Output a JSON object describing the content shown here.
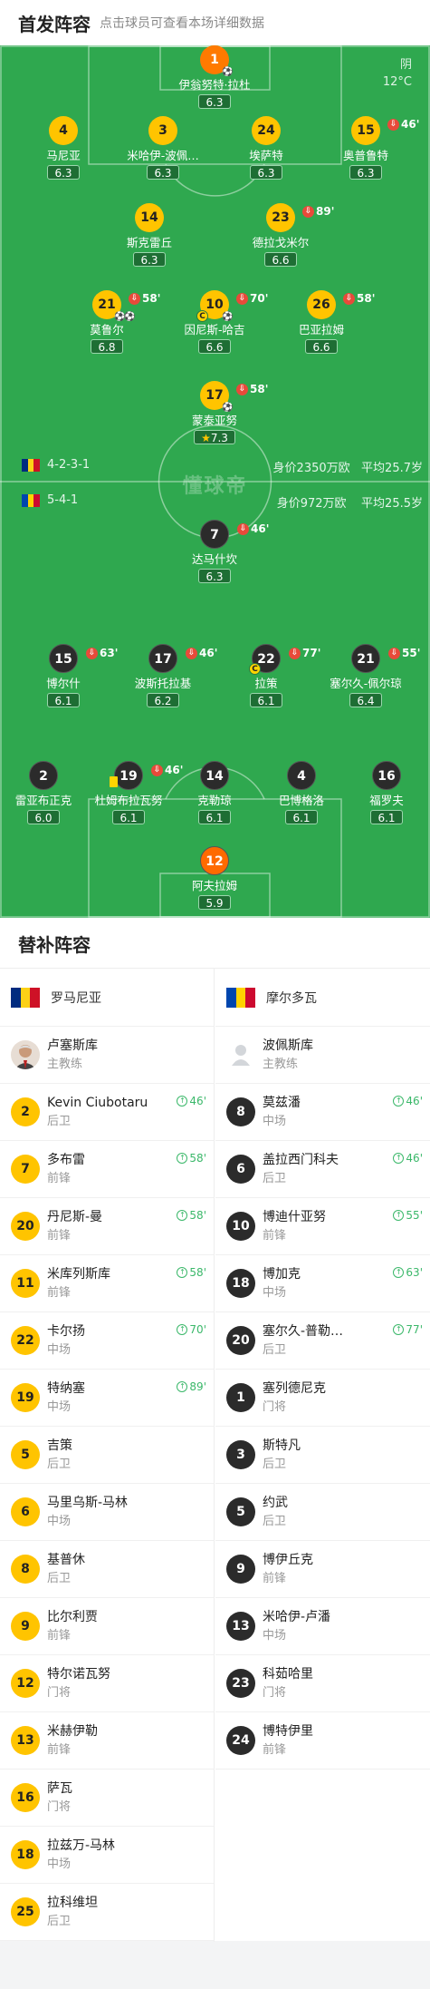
{
  "header": {
    "title": "首发阵容",
    "subtitle": "点击球员可查看本场详细数据"
  },
  "weather": {
    "condition": "阴",
    "temp": "12°C"
  },
  "watermark": "懂球帝",
  "home_team": {
    "formation": "4-2-3-1",
    "value": "身价2350万欧",
    "age": "平均25.7岁",
    "flag_colors": [
      "#002b7f",
      "#fcd116",
      "#ce1126"
    ],
    "players": [
      {
        "id": "gk",
        "num": "1",
        "name": "伊翁努特·拉杜",
        "rating": "6.3",
        "ball": true
      },
      {
        "id": "d1",
        "num": "4",
        "name": "马尼亚",
        "rating": "6.3"
      },
      {
        "id": "d2",
        "num": "3",
        "name": "米哈伊-波佩…",
        "rating": "6.3"
      },
      {
        "id": "d3",
        "num": "24",
        "name": "埃萨特",
        "rating": "6.3"
      },
      {
        "id": "d4",
        "num": "15",
        "name": "奥普鲁特",
        "rating": "6.3",
        "sub": "46'"
      },
      {
        "id": "m1",
        "num": "14",
        "name": "斯克雷丘",
        "rating": "6.3"
      },
      {
        "id": "m2",
        "num": "23",
        "name": "德拉戈米尔",
        "rating": "6.6",
        "sub": "89'"
      },
      {
        "id": "a1",
        "num": "21",
        "name": "莫鲁尔",
        "rating": "6.8",
        "sub": "58'",
        "goals": 2
      },
      {
        "id": "a2",
        "num": "10",
        "name": "因尼斯-哈吉",
        "rating": "6.6",
        "sub": "70'",
        "captain": true,
        "ball": true
      },
      {
        "id": "a3",
        "num": "26",
        "name": "巴亚拉姆",
        "rating": "6.6",
        "sub": "58'"
      },
      {
        "id": "fw",
        "num": "17",
        "name": "蒙泰亚努",
        "rating": "7.3",
        "sub": "58'",
        "star": true,
        "ball": true
      }
    ]
  },
  "away_team": {
    "formation": "5-4-1",
    "value": "身价972万欧",
    "age": "平均25.5岁",
    "flag_colors": [
      "#0046ae",
      "#ffd200",
      "#cc092f"
    ],
    "players": [
      {
        "id": "fw",
        "num": "7",
        "name": "达马什坎",
        "rating": "6.3",
        "sub": "46'"
      },
      {
        "id": "m1",
        "num": "15",
        "name": "博尔什",
        "rating": "6.1",
        "sub": "63'"
      },
      {
        "id": "m2",
        "num": "17",
        "name": "波斯托拉基",
        "rating": "6.2",
        "sub": "46'"
      },
      {
        "id": "m3",
        "num": "22",
        "name": "拉策",
        "rating": "6.1",
        "sub": "77'",
        "captain": true
      },
      {
        "id": "m4",
        "num": "21",
        "name": "塞尔久-佩尔琼",
        "rating": "6.4",
        "sub": "55'"
      },
      {
        "id": "d1",
        "num": "2",
        "name": "雷亚布正克",
        "rating": "6.0"
      },
      {
        "id": "d2",
        "num": "19",
        "name": "杜姆布拉瓦努",
        "rating": "6.1",
        "sub": "46'",
        "ycard": true
      },
      {
        "id": "d3",
        "num": "14",
        "name": "克勒琼",
        "rating": "6.1"
      },
      {
        "id": "d4",
        "num": "4",
        "name": "巴博格洛",
        "rating": "6.1"
      },
      {
        "id": "d5",
        "num": "16",
        "name": "福罗夫",
        "rating": "6.1"
      },
      {
        "id": "gk",
        "num": "12",
        "name": "阿夫拉姆",
        "rating": "5.9"
      }
    ]
  },
  "subs": {
    "title": "替补阵容",
    "home": {
      "team": "罗马尼亚",
      "coach": "卢塞斯库",
      "coach_role": "主教练",
      "players": [
        {
          "num": "2",
          "name": "Kevin Ciubotaru",
          "pos": "后卫",
          "on": "46'"
        },
        {
          "num": "7",
          "name": "多布雷",
          "pos": "前锋",
          "on": "58'"
        },
        {
          "num": "20",
          "name": "丹尼斯-曼",
          "pos": "前锋",
          "on": "58'"
        },
        {
          "num": "11",
          "name": "米库列斯库",
          "pos": "前锋",
          "on": "58'"
        },
        {
          "num": "22",
          "name": "卡尔扬",
          "pos": "中场",
          "on": "70'"
        },
        {
          "num": "19",
          "name": "特纳塞",
          "pos": "中场",
          "on": "89'"
        },
        {
          "num": "5",
          "name": "吉策",
          "pos": "后卫"
        },
        {
          "num": "6",
          "name": "马里乌斯-马林",
          "pos": "中场"
        },
        {
          "num": "8",
          "name": "基普休",
          "pos": "后卫"
        },
        {
          "num": "9",
          "name": "比尔利贾",
          "pos": "前锋"
        },
        {
          "num": "12",
          "name": "特尔诺瓦努",
          "pos": "门将"
        },
        {
          "num": "13",
          "name": "米赫伊勒",
          "pos": "前锋"
        },
        {
          "num": "16",
          "name": "萨瓦",
          "pos": "门将"
        },
        {
          "num": "18",
          "name": "拉兹万-马林",
          "pos": "中场"
        },
        {
          "num": "25",
          "name": "拉科维坦",
          "pos": "后卫"
        }
      ]
    },
    "away": {
      "team": "摩尔多瓦",
      "coach": "波佩斯库",
      "coach_role": "主教练",
      "players": [
        {
          "num": "8",
          "name": "莫兹潘",
          "pos": "中场",
          "on": "46'"
        },
        {
          "num": "6",
          "name": "盖拉西门科夫",
          "pos": "后卫",
          "on": "46'"
        },
        {
          "num": "10",
          "name": "博迪什亚努",
          "pos": "前锋",
          "on": "55'"
        },
        {
          "num": "18",
          "name": "博加克",
          "pos": "中场",
          "on": "63'"
        },
        {
          "num": "20",
          "name": "塞尔久-普勒…",
          "pos": "后卫",
          "on": "77'"
        },
        {
          "num": "1",
          "name": "塞列德尼克",
          "pos": "门将"
        },
        {
          "num": "3",
          "name": "斯特凡",
          "pos": "后卫"
        },
        {
          "num": "5",
          "name": "约武",
          "pos": "后卫"
        },
        {
          "num": "9",
          "name": "博伊丘克",
          "pos": "前锋"
        },
        {
          "num": "13",
          "name": "米哈伊-卢潘",
          "pos": "中场"
        },
        {
          "num": "23",
          "name": "科茹哈里",
          "pos": "门将"
        },
        {
          "num": "24",
          "name": "博特伊里",
          "pos": "前锋"
        }
      ]
    }
  }
}
